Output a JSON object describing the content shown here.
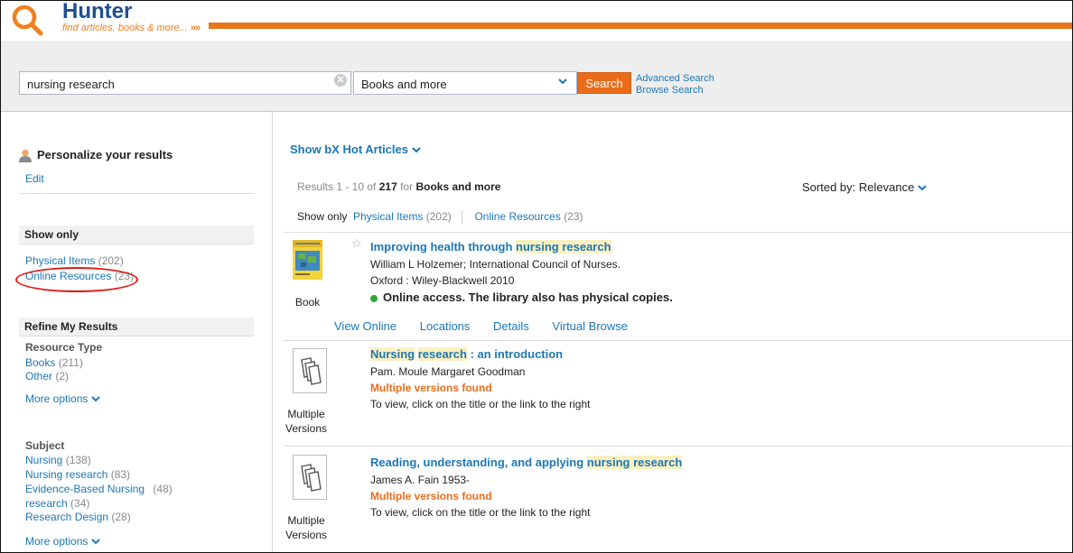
{
  "header": {
    "logo_title": "Hunter",
    "logo_tagline": "find articles, books & more...",
    "logo_arrows": "»»"
  },
  "search": {
    "query": "nursing research",
    "clear_glyph": "✕",
    "scope": "Books and more",
    "scope_chevron": "⌄",
    "button_label": "Search",
    "advanced_link": "Advanced Search",
    "browse_link": "Browse Search"
  },
  "sidebar": {
    "personalize": {
      "title": "Personalize your results",
      "edit": "Edit"
    },
    "show_only": {
      "title": "Show only",
      "items": [
        {
          "label": "Physical Items",
          "count": "(202)"
        },
        {
          "label": "Online Resources",
          "count": "(23)"
        }
      ]
    },
    "refine": {
      "title": "Refine My Results",
      "resource_type": {
        "title": "Resource Type",
        "items": [
          {
            "label": "Books",
            "count": "(211)"
          },
          {
            "label": "Other",
            "count": "(2)"
          }
        ],
        "more": "More options"
      },
      "subject": {
        "title": "Subject",
        "items": [
          {
            "label": "Nursing",
            "count": "(138)"
          },
          {
            "label": "Nursing research",
            "count": "(83)"
          },
          {
            "label": "Evidence-Based Nursing",
            "count": "(48)"
          },
          {
            "label": "research",
            "count": "(34)"
          },
          {
            "label": "Research Design",
            "count": "(28)"
          }
        ],
        "more": "More options"
      }
    }
  },
  "main": {
    "hot_articles": "Show bX Hot Articles",
    "results_prefix": "Results 1 - 10 of",
    "results_total": "217",
    "results_for": "for",
    "results_scope": "Books and more",
    "sorted_label": "Sorted by:",
    "sorted_value": "Relevance",
    "show_only_label": "Show only",
    "filters": [
      {
        "label": "Physical Items",
        "count": "(202)"
      },
      {
        "label": "Online Resources",
        "count": "(23)"
      }
    ],
    "results": [
      {
        "type_label": "Book",
        "title_pre": "Improving health through ",
        "title_hl": "nursing research",
        "title_post": "",
        "author": "William L Holzemer; International Council of Nurses.",
        "publisher": "Oxford : Wiley-Blackwell 2010",
        "availability": "Online access. The library also has physical copies.",
        "actions": [
          "View Online",
          "Locations",
          "Details",
          "Virtual Browse"
        ]
      },
      {
        "type_label_1": "Multiple",
        "type_label_2": "Versions",
        "title_hl1": "Nursing",
        "title_hl2": "research",
        "title_post": " : an introduction",
        "author": "Pam. Moule Margaret Goodman",
        "versions": "Multiple versions found",
        "note": "To view, click on the title or the link to the right"
      },
      {
        "type_label_1": "Multiple",
        "type_label_2": "Versions",
        "title_pre": "Reading, understanding, and applying ",
        "title_hl": "nursing research",
        "author": "James A. Fain 1953-",
        "versions": "Multiple versions found",
        "note": "To view, click on the title or the link to the right"
      }
    ]
  },
  "colors": {
    "accent_orange": "#ea6d1b",
    "link_blue": "#1c77b7",
    "annotation_red": "#e01a1a"
  }
}
